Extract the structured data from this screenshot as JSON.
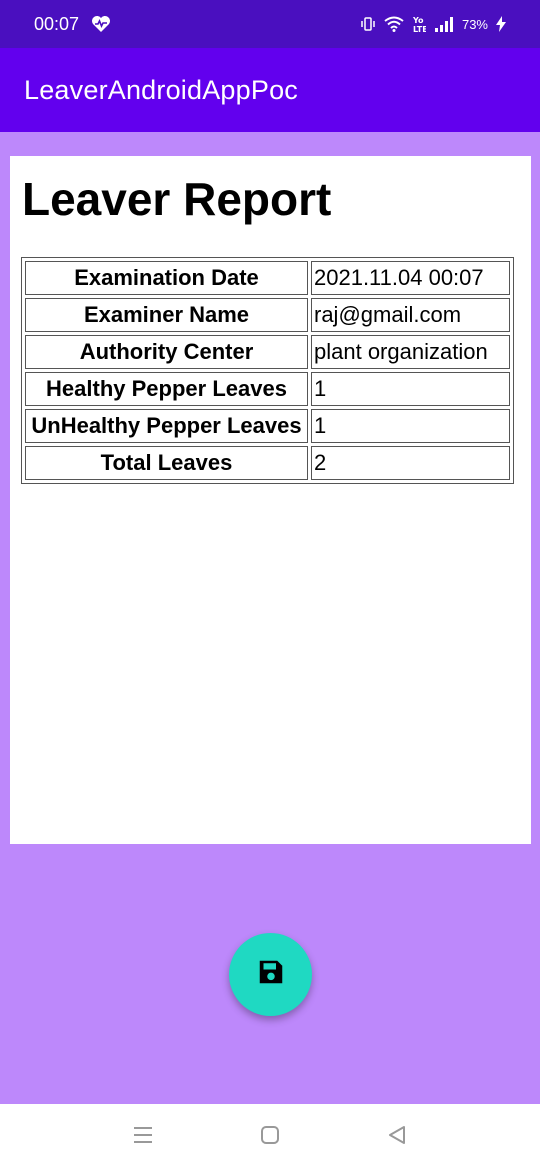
{
  "status_bar": {
    "time": "00:07",
    "battery": "73%",
    "icons": [
      "heart-icon",
      "vibrate-icon",
      "wifi-icon",
      "volte-icon",
      "signal-icon",
      "charging-icon"
    ]
  },
  "app_bar": {
    "title": "LeaverAndroidAppPoc"
  },
  "report": {
    "title": "Leaver Report",
    "rows": [
      {
        "label": "Examination Date",
        "value": "2021.11.04 00:07"
      },
      {
        "label": "Examiner Name",
        "value": "raj@gmail.com"
      },
      {
        "label": "Authority Center",
        "value": "plant organization"
      },
      {
        "label": "Healthy Pepper Leaves",
        "value": "1"
      },
      {
        "label": "UnHealthy Pepper Leaves",
        "value": "1"
      },
      {
        "label": "Total Leaves",
        "value": "2"
      }
    ]
  },
  "fab": {
    "icon": "save-icon",
    "color": "#1fd9c2"
  },
  "colors": {
    "status_bar": "#4a0fbf",
    "app_bar": "#6200ee",
    "background": "#bd88fb"
  },
  "nav_bar": {
    "icons": [
      "recents-icon",
      "home-icon",
      "back-icon"
    ]
  }
}
